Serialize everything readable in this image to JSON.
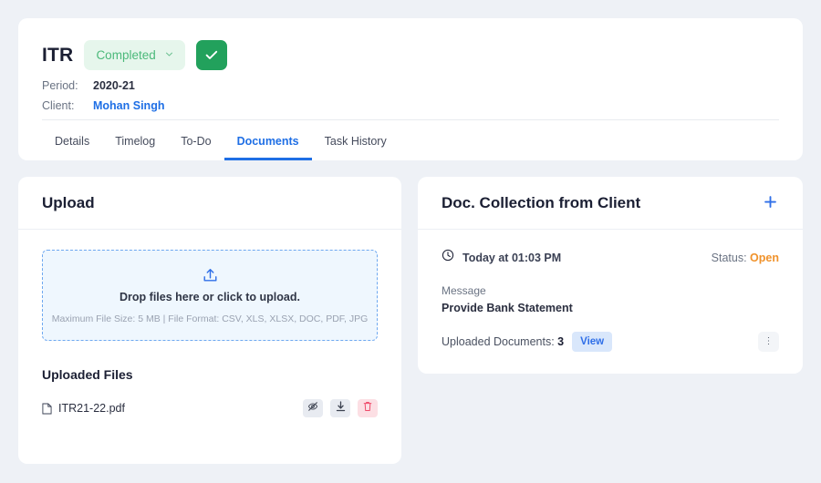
{
  "header": {
    "title": "ITR",
    "status_chip": {
      "label": "Completed",
      "caret_icon": "chevron-down-icon",
      "bg": "#e6f6ec",
      "fg": "#4bb97a"
    },
    "complete_button": {
      "icon": "check-icon",
      "bg": "#22a15c"
    },
    "meta": [
      {
        "label": "Period:",
        "value": "2020-21",
        "is_link": false
      },
      {
        "label": "Client:",
        "value": "Mohan Singh",
        "is_link": true
      }
    ]
  },
  "tabs": {
    "items": [
      {
        "label": "Details",
        "active": false
      },
      {
        "label": "Timelog",
        "active": false
      },
      {
        "label": "To-Do",
        "active": false
      },
      {
        "label": "Documents",
        "active": true
      },
      {
        "label": "Task History",
        "active": false
      }
    ],
    "active_color": "#1f6fe5"
  },
  "upload_card": {
    "title": "Upload",
    "dropzone": {
      "icon": "upload-tray-icon",
      "primary_text": "Drop files here or click to upload.",
      "hint_text": "Maximum File Size: 5 MB | File Format: CSV, XLS, XLSX, DOC, PDF, JPG",
      "border_color": "#6ea8f0",
      "bg": "#eff7fe"
    },
    "uploaded_title": "Uploaded Files",
    "files": [
      {
        "name": "ITR21-22.pdf",
        "file_icon": "document-icon",
        "actions": [
          {
            "icon": "eye-off-icon",
            "style": "gray"
          },
          {
            "icon": "download-icon",
            "style": "gray"
          },
          {
            "icon": "trash-icon",
            "style": "pink"
          }
        ]
      }
    ]
  },
  "doc_collection_card": {
    "title": "Doc. Collection from Client",
    "add_icon": "plus-icon",
    "entry": {
      "clock_icon": "clock-icon",
      "time_text": "Today at 01:03 PM",
      "status_label": "Status:",
      "status_value": "Open",
      "status_color": "#f0922b",
      "message_label": "Message",
      "message_value": "Provide Bank Statement",
      "documents_label": "Uploaded Documents:",
      "documents_count": "3",
      "view_label": "View",
      "menu_icon": "kebab-menu-icon",
      "menu_glyph": "⋮"
    }
  }
}
